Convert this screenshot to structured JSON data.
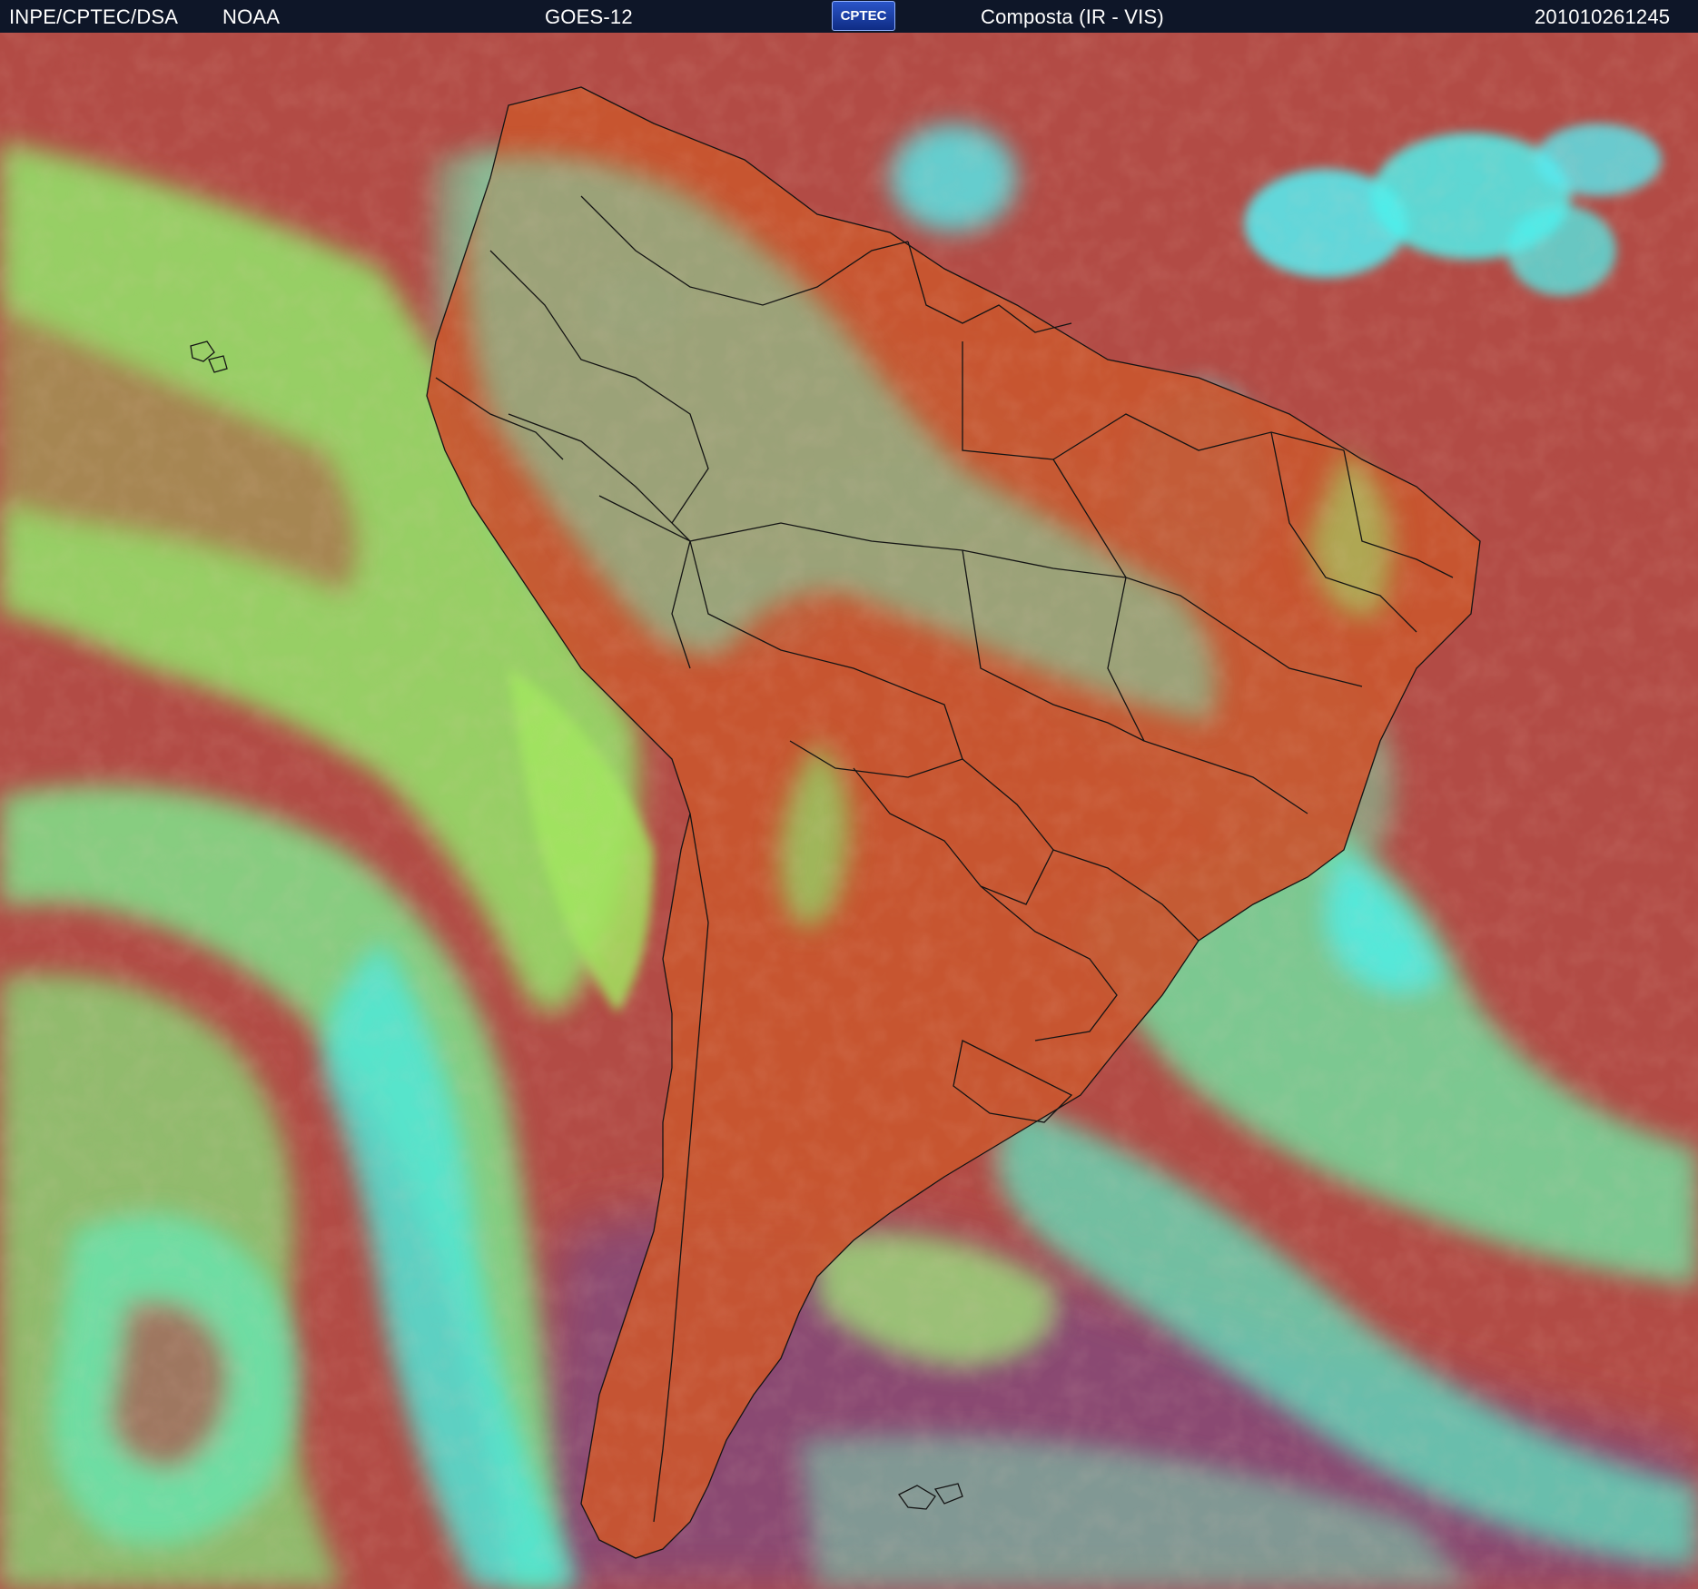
{
  "header": {
    "institution": "INPE/CPTEC/DSA",
    "agency": "NOAA",
    "satellite": "GOES-12",
    "logo_text": "CPTEC",
    "product": "Composta (IR - VIS)",
    "timestamp": "201010261245"
  },
  "colors": {
    "header_background": "#0e1628",
    "header_text": "#ffffff",
    "clear_ocean": "#b24b45",
    "land_surface": "#c8552f",
    "low_cloud": "#8fe36a",
    "high_cloud": "#4ff0ec",
    "southern_ocean": "#8a4a72",
    "borders": "#141414"
  }
}
